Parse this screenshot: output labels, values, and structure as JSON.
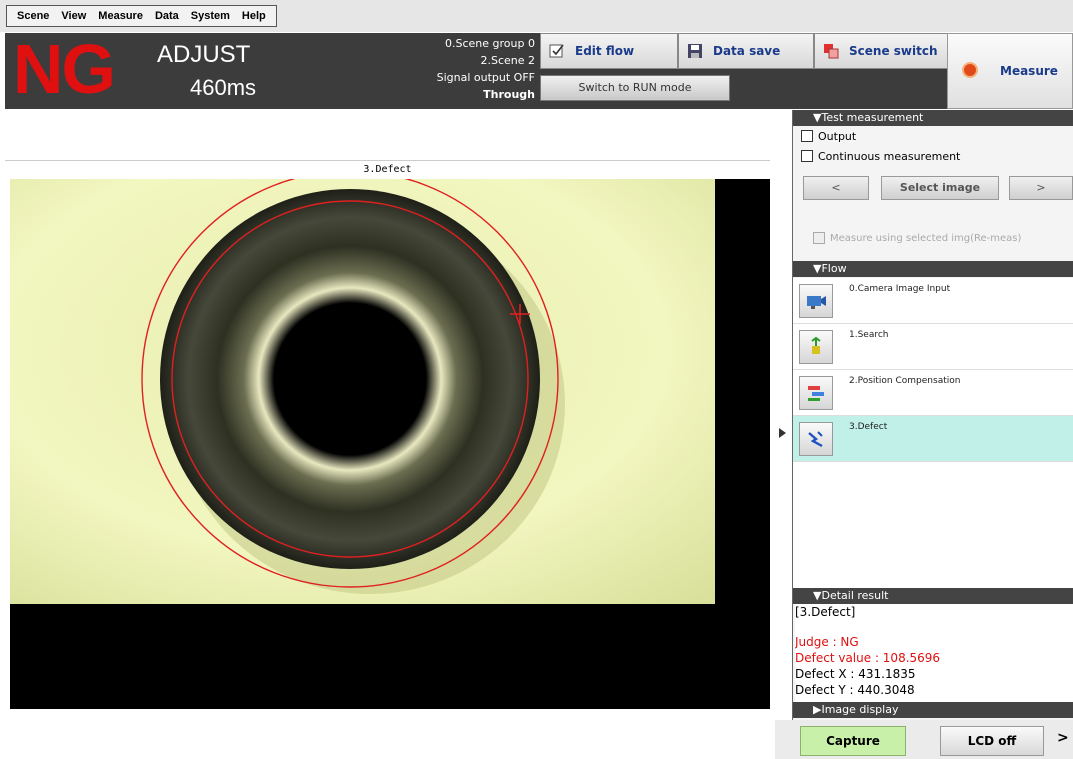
{
  "menu": {
    "items": [
      "Scene",
      "View",
      "Measure",
      "Data",
      "System",
      "Help"
    ]
  },
  "header": {
    "judge": "NG",
    "mode": "ADJUST",
    "time": "460ms",
    "scene_group": "0.Scene group 0",
    "scene": "2.Scene 2",
    "signal_output": "Signal output OFF",
    "through": "Through",
    "edit_flow": "Edit flow",
    "data_save": "Data save",
    "scene_switch": "Scene switch",
    "run_mode": "Switch to RUN mode",
    "measure": "Measure"
  },
  "image": {
    "title": "3.Defect"
  },
  "test_measurement": {
    "header": "Test measurement",
    "output_label": "Output",
    "continuous_label": "Continuous measurement",
    "prev": "<",
    "select_image": "Select image",
    "next": ">",
    "reuse_label": "Measure using selected img(Re-meas)"
  },
  "flow": {
    "header": "Flow",
    "items": [
      {
        "label": "0.Camera Image Input",
        "icon": "camera-icon"
      },
      {
        "label": "1.Search",
        "icon": "search-icon"
      },
      {
        "label": "2.Position Compensation",
        "icon": "position-compensation-icon"
      },
      {
        "label": "3.Defect",
        "icon": "defect-icon"
      }
    ],
    "selected_index": 3
  },
  "detail": {
    "header": "Detail result",
    "unit": "[3.Defect]",
    "judge": "Judge : NG",
    "defect_value": "Defect value : 108.5696",
    "defect_x": "Defect X : 431.1835",
    "defect_y": "Defect Y : 440.3048"
  },
  "image_display": {
    "header": "Image display"
  },
  "bottom": {
    "capture": "Capture",
    "lcd_off": "LCD off",
    "more": ">"
  },
  "colors": {
    "judge_ng": "#e01010",
    "header_bg": "#3c3c3c",
    "selected_flow": "#c0f0e8",
    "capture_bg": "#c8f0a8"
  }
}
